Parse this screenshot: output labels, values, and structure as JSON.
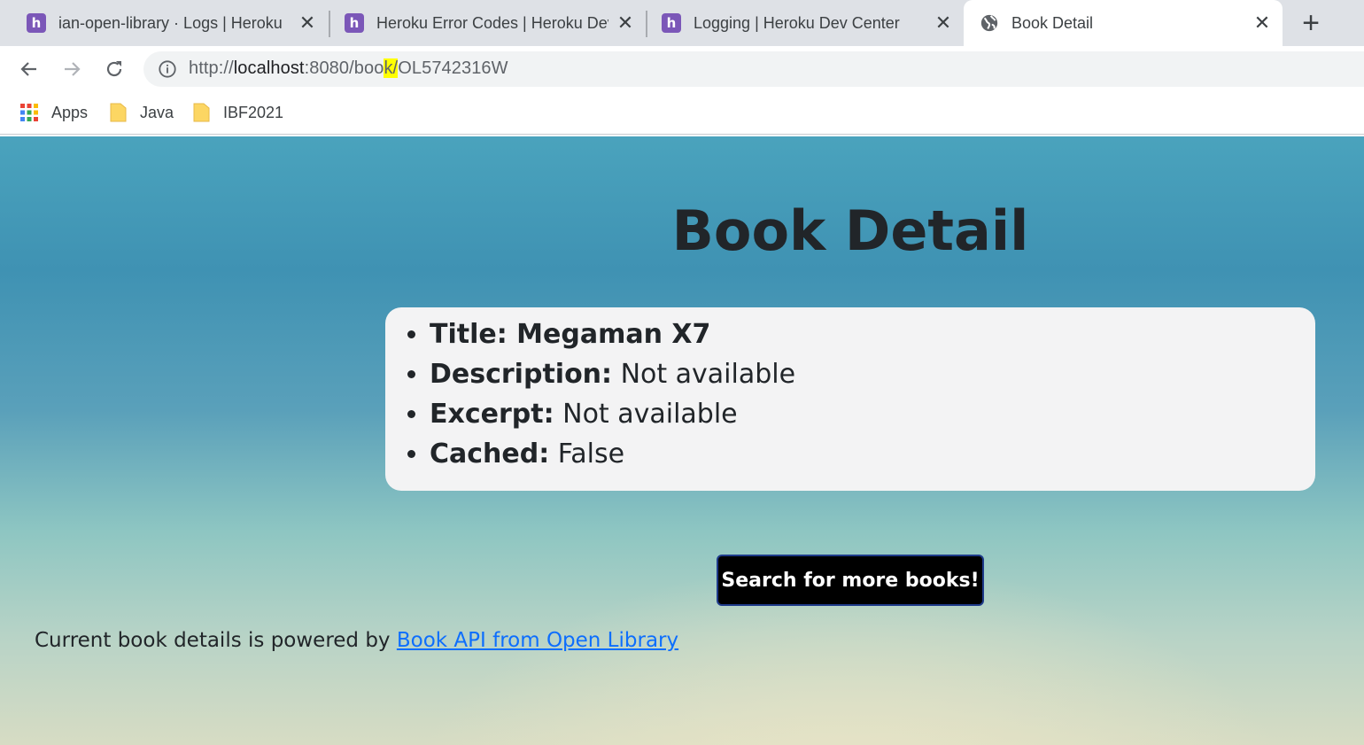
{
  "browser": {
    "tabs": [
      {
        "title": "ian-open-library · Logs | Heroku",
        "icon": "heroku-icon"
      },
      {
        "title": "Heroku Error Codes | Heroku Dev",
        "icon": "heroku-icon"
      },
      {
        "title": "Logging | Heroku Dev Center",
        "icon": "heroku-icon"
      },
      {
        "title": "Book Detail",
        "icon": "globe-icon",
        "active": true
      }
    ],
    "new_tab_label": "+",
    "url": {
      "scheme": "http://",
      "host": "localhost",
      "path_before_highlight": ":8080/boo",
      "highlight": "k/",
      "path_after_highlight": "OL5742316W"
    },
    "bookmarks": [
      {
        "label": "Apps",
        "icon": "apps-grid-icon"
      },
      {
        "label": "Java",
        "icon": "folder-icon"
      },
      {
        "label": "IBF2021",
        "icon": "folder-icon"
      }
    ]
  },
  "page": {
    "heading": "Book Detail",
    "details": [
      {
        "key": "Title: Megaman X7",
        "value": ""
      },
      {
        "key": "Description:",
        "value": " Not available"
      },
      {
        "key": "Excerpt:",
        "value": " Not available"
      },
      {
        "key": "Cached:",
        "value": " False"
      }
    ],
    "search_button": "Search for more books!",
    "footer_prefix": "Current book details is powered by ",
    "footer_link": "Book API from Open Library"
  },
  "colors": {
    "heroku_purple": "#7b57b8",
    "link": "#0d6efd",
    "highlight": "#ffff00"
  }
}
